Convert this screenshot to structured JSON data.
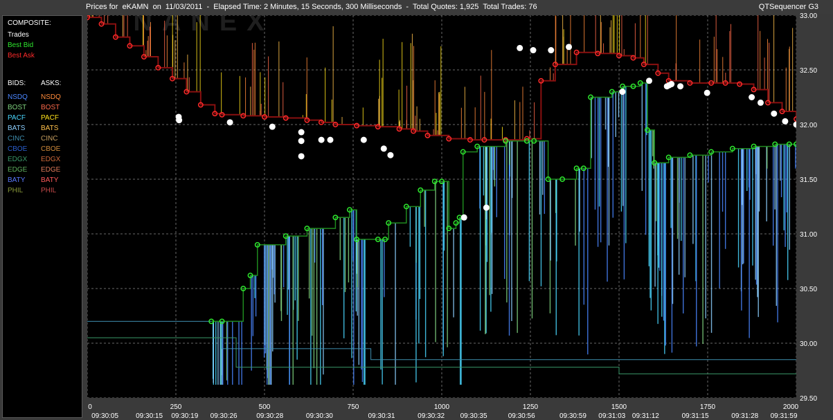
{
  "window": {
    "title": "Prices for  eKAMN  on  11/03/2011  -  Elapsed Time: 2 Minutes, 15 Seconds, 300 Milliseconds  -  Total Quotes: 1,925  Total Trades: 76",
    "app_name": "QTSequencer G3",
    "watermark": "NANEX"
  },
  "legend": {
    "composite_header": "COMPOSITE:",
    "composite": [
      {
        "label": "Trades",
        "color": "#ffffff"
      },
      {
        "label": "Best Bid",
        "color": "#2ee82e"
      },
      {
        "label": "Best Ask",
        "color": "#ff2a2a"
      }
    ],
    "bids_header": "BIDS:",
    "asks_header": "ASKS:",
    "exchanges": [
      {
        "bid": "NSDQ",
        "ask": "NSDQ",
        "bid_color": "#4a86ff",
        "ask_color": "#ff8a3a"
      },
      {
        "bid": "BOST",
        "ask": "BOST",
        "bid_color": "#7fd27f",
        "ask_color": "#ff6a4a"
      },
      {
        "bid": "PACF",
        "ask": "PACF",
        "bid_color": "#4ad7ff",
        "ask_color": "#ffe21a"
      },
      {
        "bid": "BATS",
        "ask": "BATS",
        "bid_color": "#8ccfff",
        "ask_color": "#ffc04a"
      },
      {
        "bid": "CINC",
        "ask": "CINC",
        "bid_color": "#3f8fb0",
        "ask_color": "#c8a060"
      },
      {
        "bid": "CBOE",
        "ask": "CBOE",
        "bid_color": "#2a5fcf",
        "ask_color": "#d08a3a"
      },
      {
        "bid": "EDGX",
        "ask": "EDGX",
        "bid_color": "#3a9a6a",
        "ask_color": "#d06a3a"
      },
      {
        "bid": "EDGE",
        "ask": "EDGE",
        "bid_color": "#5fb05f",
        "ask_color": "#e07a5a"
      },
      {
        "bid": "BATY",
        "ask": "BATY",
        "bid_color": "#5a7aff",
        "ask_color": "#ff5a5a"
      },
      {
        "bid": "PHIL",
        "ask": "PHIL",
        "bid_color": "#8a9a3a",
        "ask_color": "#c84a4a"
      }
    ]
  },
  "chart_data": {
    "type": "line",
    "title": "Prices for eKAMN on 11/03/2011",
    "x_axis": {
      "label": "",
      "range": [
        0,
        2000
      ],
      "ticks": [
        0,
        250,
        500,
        750,
        1000,
        1250,
        1500,
        1750,
        2000
      ],
      "time_labels": [
        {
          "x": 50,
          "label": "09:30:05"
        },
        {
          "x": 175,
          "label": "09:30:15"
        },
        {
          "x": 275,
          "label": "09:30:19"
        },
        {
          "x": 385,
          "label": "09:30:26"
        },
        {
          "x": 515,
          "label": "09:30:28"
        },
        {
          "x": 655,
          "label": "09:30:30"
        },
        {
          "x": 830,
          "label": "09:30:31"
        },
        {
          "x": 970,
          "label": "09:30:32"
        },
        {
          "x": 1090,
          "label": "09:30:35"
        },
        {
          "x": 1225,
          "label": "09:30:56"
        },
        {
          "x": 1370,
          "label": "09:30:59"
        },
        {
          "x": 1480,
          "label": "09:31:03"
        },
        {
          "x": 1575,
          "label": "09:31:12"
        },
        {
          "x": 1715,
          "label": "09:31:15"
        },
        {
          "x": 1855,
          "label": "09:31:28"
        },
        {
          "x": 1965,
          "label": "09:31:59"
        }
      ]
    },
    "y_axis": {
      "label": "",
      "range": [
        29.5,
        33.0
      ],
      "ticks": [
        29.5,
        30.0,
        30.5,
        31.0,
        31.5,
        32.0,
        32.5,
        33.0
      ],
      "tick_labels": [
        "29.50",
        "30.00",
        "30.50",
        "31.00",
        "31.50",
        "32.00",
        "32.50",
        "33.00"
      ]
    },
    "grid": true,
    "series": [
      {
        "name": "Best Ask",
        "color": "#ff2a2a",
        "points": [
          [
            0,
            32.98
          ],
          [
            40,
            32.92
          ],
          [
            80,
            32.8
          ],
          [
            120,
            32.72
          ],
          [
            160,
            32.62
          ],
          [
            200,
            32.52
          ],
          [
            240,
            32.42
          ],
          [
            280,
            32.3
          ],
          [
            320,
            32.18
          ],
          [
            360,
            32.1
          ],
          [
            380,
            32.09
          ],
          [
            440,
            32.08
          ],
          [
            500,
            32.07
          ],
          [
            560,
            32.06
          ],
          [
            620,
            32.04
          ],
          [
            660,
            32.02
          ],
          [
            700,
            32.0
          ],
          [
            760,
            31.99
          ],
          [
            820,
            31.98
          ],
          [
            880,
            31.96
          ],
          [
            920,
            31.94
          ],
          [
            960,
            31.9
          ],
          [
            1020,
            31.87
          ],
          [
            1080,
            31.86
          ],
          [
            1120,
            31.86
          ],
          [
            1180,
            31.86
          ],
          [
            1240,
            31.87
          ],
          [
            1280,
            32.4
          ],
          [
            1320,
            32.55
          ],
          [
            1380,
            32.66
          ],
          [
            1440,
            32.65
          ],
          [
            1500,
            32.63
          ],
          [
            1540,
            32.61
          ],
          [
            1570,
            32.55
          ],
          [
            1610,
            32.47
          ],
          [
            1640,
            32.4
          ],
          [
            1700,
            32.38
          ],
          [
            1760,
            32.38
          ],
          [
            1800,
            32.38
          ],
          [
            1840,
            32.37
          ],
          [
            1880,
            32.32
          ],
          [
            1920,
            32.2
          ],
          [
            1960,
            32.12
          ],
          [
            2000,
            32.05
          ]
        ]
      },
      {
        "name": "Best Bid",
        "color": "#2ee82e",
        "points": [
          [
            350,
            30.2
          ],
          [
            380,
            30.2
          ],
          [
            440,
            30.5
          ],
          [
            460,
            30.62
          ],
          [
            480,
            30.9
          ],
          [
            560,
            30.98
          ],
          [
            620,
            31.05
          ],
          [
            700,
            31.15
          ],
          [
            740,
            31.22
          ],
          [
            760,
            30.95
          ],
          [
            820,
            30.95
          ],
          [
            840,
            30.95
          ],
          [
            850,
            31.1
          ],
          [
            900,
            31.25
          ],
          [
            940,
            31.4
          ],
          [
            980,
            31.48
          ],
          [
            1000,
            31.48
          ],
          [
            1020,
            31.05
          ],
          [
            1040,
            31.1
          ],
          [
            1050,
            31.15
          ],
          [
            1060,
            31.75
          ],
          [
            1100,
            31.8
          ],
          [
            1180,
            31.85
          ],
          [
            1240,
            31.85
          ],
          [
            1260,
            31.85
          ],
          [
            1300,
            31.5
          ],
          [
            1340,
            31.5
          ],
          [
            1380,
            31.6
          ],
          [
            1400,
            31.6
          ],
          [
            1420,
            32.25
          ],
          [
            1480,
            32.3
          ],
          [
            1510,
            32.35
          ],
          [
            1540,
            32.35
          ],
          [
            1560,
            32.38
          ],
          [
            1580,
            31.95
          ],
          [
            1600,
            31.65
          ],
          [
            1640,
            31.7
          ],
          [
            1700,
            31.72
          ],
          [
            1760,
            31.75
          ],
          [
            1820,
            31.78
          ],
          [
            1880,
            31.8
          ],
          [
            1940,
            31.82
          ],
          [
            1980,
            31.82
          ],
          [
            2000,
            31.82
          ]
        ]
      },
      {
        "name": "Trades",
        "color": "#ffffff",
        "points": [
          [
            410,
            32.07
          ],
          [
            412,
            32.04
          ],
          [
            640,
            32.02
          ],
          [
            830,
            31.98
          ],
          [
            960,
            31.93
          ],
          [
            960,
            31.85
          ],
          [
            960,
            31.71
          ],
          [
            1050,
            31.86
          ],
          [
            1090,
            31.86
          ],
          [
            1240,
            31.86
          ],
          [
            1330,
            31.78
          ],
          [
            1360,
            31.72
          ],
          [
            1690,
            31.15
          ],
          [
            1790,
            31.24
          ],
          [
            1940,
            32.7
          ],
          [
            2000,
            32.68
          ],
          [
            2080,
            32.68
          ],
          [
            2160,
            32.71
          ],
          [
            2400,
            32.3
          ],
          [
            2520,
            32.4
          ],
          [
            2600,
            32.35
          ],
          [
            2610,
            32.36
          ],
          [
            2620,
            32.37
          ],
          [
            2660,
            32.35
          ],
          [
            2780,
            32.29
          ],
          [
            2980,
            32.25
          ],
          [
            3020,
            32.2
          ],
          [
            3080,
            32.1
          ],
          [
            3130,
            32.03
          ],
          [
            3180,
            32.0
          ]
        ]
      }
    ],
    "legend_position": "left panel"
  }
}
